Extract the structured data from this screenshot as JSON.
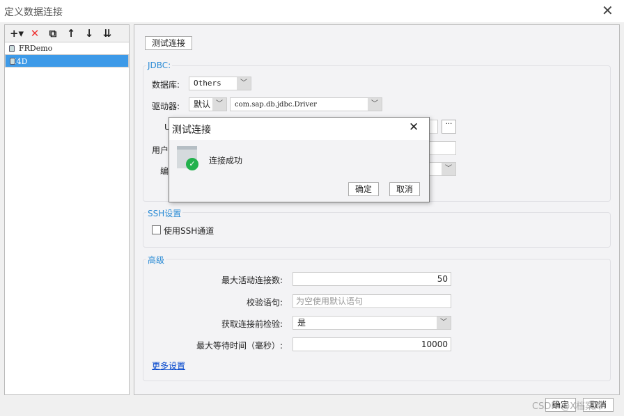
{
  "window": {
    "title": "定义数据连接",
    "close": "✕"
  },
  "toolbar": {
    "add": "+▾",
    "delete": "✕",
    "copy": "⧉",
    "up": "↑",
    "down": "↓",
    "sort": "⇊"
  },
  "connections": [
    {
      "name": "FRDemo"
    },
    {
      "name": "H4D",
      "selected": true
    }
  ],
  "main": {
    "test_button": "测试连接",
    "jdbc": {
      "label": "JDBC:",
      "database_label": "数据库:",
      "database_value": "Others",
      "driver_label": "驱动器:",
      "driver_mode": "默认",
      "driver_value": "com.sap.db.jdbc.Driver",
      "url_label": "U",
      "url_more": "···",
      "user_label": "用户",
      "encoding_label": "编"
    },
    "ssh": {
      "label": "SSH设置",
      "use_ssh": "使用SSH通道",
      "checked": false
    },
    "advanced": {
      "label": "高级",
      "max_active_label": "最大活动连接数:",
      "max_active": "50",
      "validation_label": "校验语句:",
      "validation_placeholder": "为空使用默认语句",
      "test_before_label": "获取连接前检验:",
      "test_before": "是",
      "max_wait_label": "最大等待时间（毫秒）:",
      "max_wait": "10000",
      "more": "更多设置"
    }
  },
  "footer": {
    "ok": "确定",
    "cancel": "取消",
    "watermark": "CSDN @X档案库"
  },
  "dialog": {
    "title": "测试连接",
    "message": "连接成功",
    "ok": "确定",
    "cancel": "取消",
    "close": "✕"
  },
  "colors": {
    "accent": "#2a8bd5",
    "selection": "#3d9ae8",
    "success": "#22b14c"
  }
}
